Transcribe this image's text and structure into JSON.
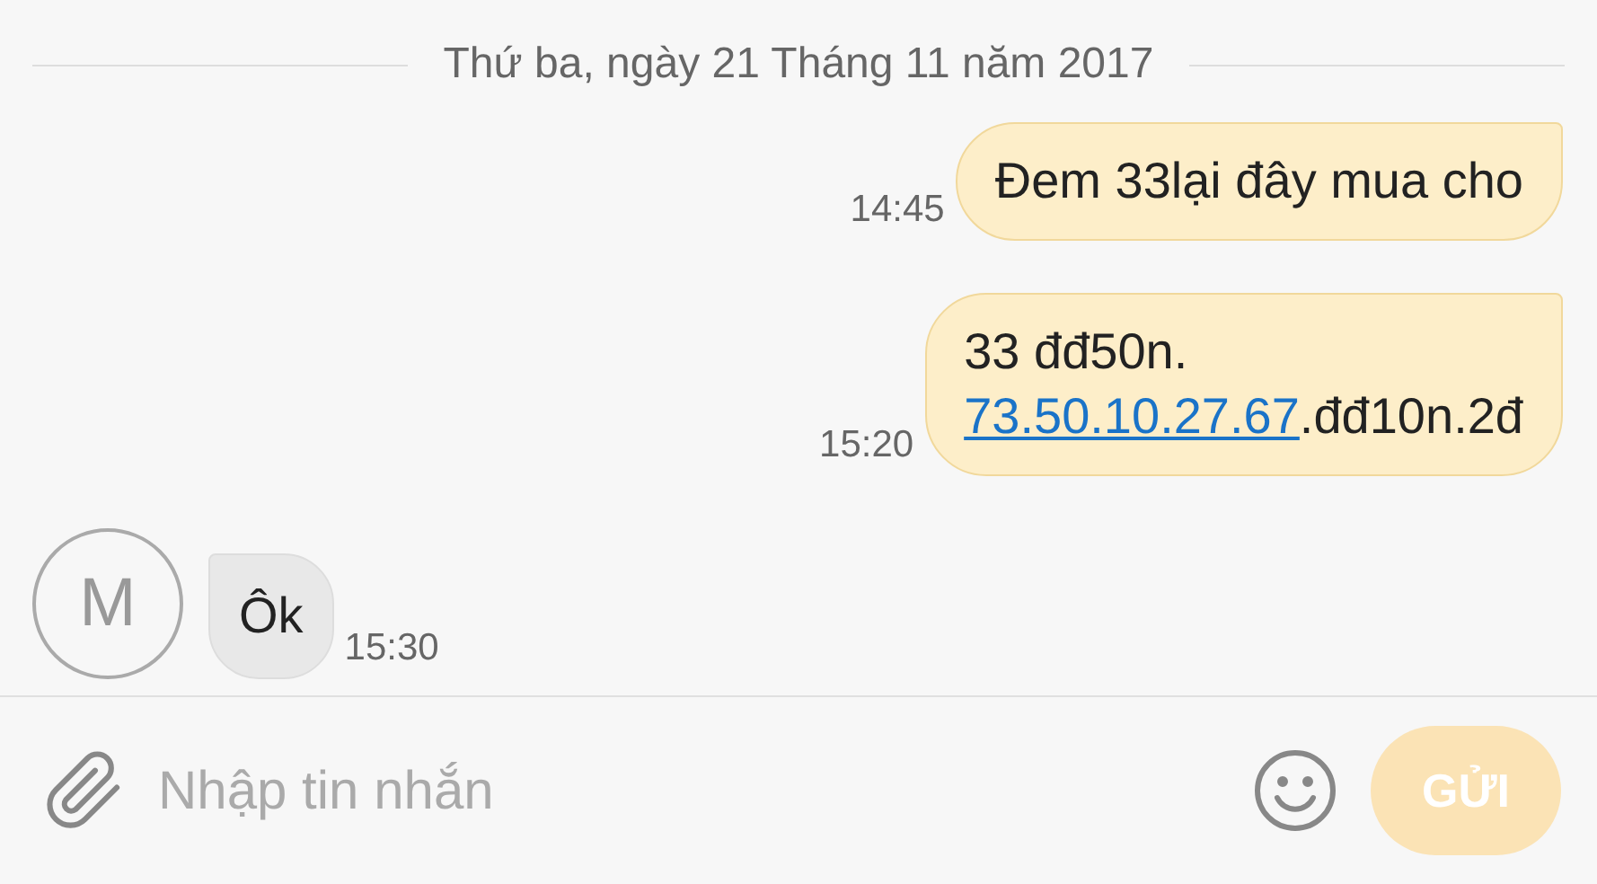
{
  "date_separator": "Thứ ba, ngày 21 Tháng 11 năm 2017",
  "messages": [
    {
      "kind": "sent",
      "time": "14:45",
      "lines": [
        [
          {
            "kind": "text",
            "text": "Đem 33lại đây mua cho"
          }
        ]
      ]
    },
    {
      "kind": "sent",
      "time": "15:20",
      "lines": [
        [
          {
            "kind": "text",
            "text": "33 đđ50n."
          }
        ],
        [
          {
            "kind": "link",
            "text": "73.50.10.27.67"
          },
          {
            "kind": "text",
            "text": ".đđ10n.2đ"
          }
        ]
      ]
    },
    {
      "kind": "received",
      "time": "15:30",
      "avatar": "M",
      "lines": [
        [
          {
            "kind": "text",
            "text": "Ôk"
          }
        ]
      ]
    }
  ],
  "composer": {
    "placeholder": "Nhập tin nhắn",
    "send_button": {
      "label": "GỬI",
      "disabled": true
    }
  }
}
